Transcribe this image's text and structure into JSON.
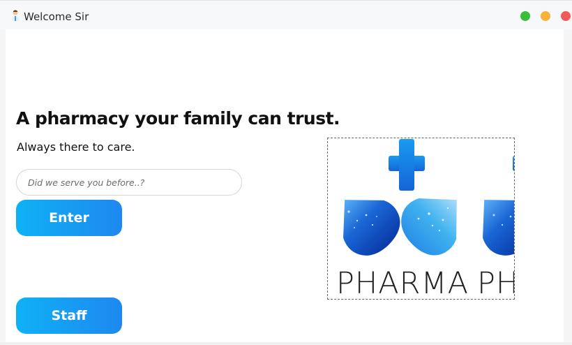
{
  "window": {
    "title": "Welcome Sir",
    "app_icon": "pharmacist-icon",
    "controls": [
      {
        "name": "maximize",
        "color": "#3bbd3b"
      },
      {
        "name": "minimize",
        "color": "#f7b23b"
      },
      {
        "name": "close",
        "color": "#ef5a5a"
      }
    ]
  },
  "main": {
    "headline": "A pharmacy your family can trust.",
    "subline": "Always there to care.",
    "search": {
      "placeholder": "Did we serve you before..?",
      "value": ""
    },
    "enter_label": "Enter",
    "staff_label": "Staff",
    "logo": {
      "text": "PHARMA",
      "icon": "pharma-logo-cross-and-drops",
      "accent": "#1e88f0"
    }
  }
}
